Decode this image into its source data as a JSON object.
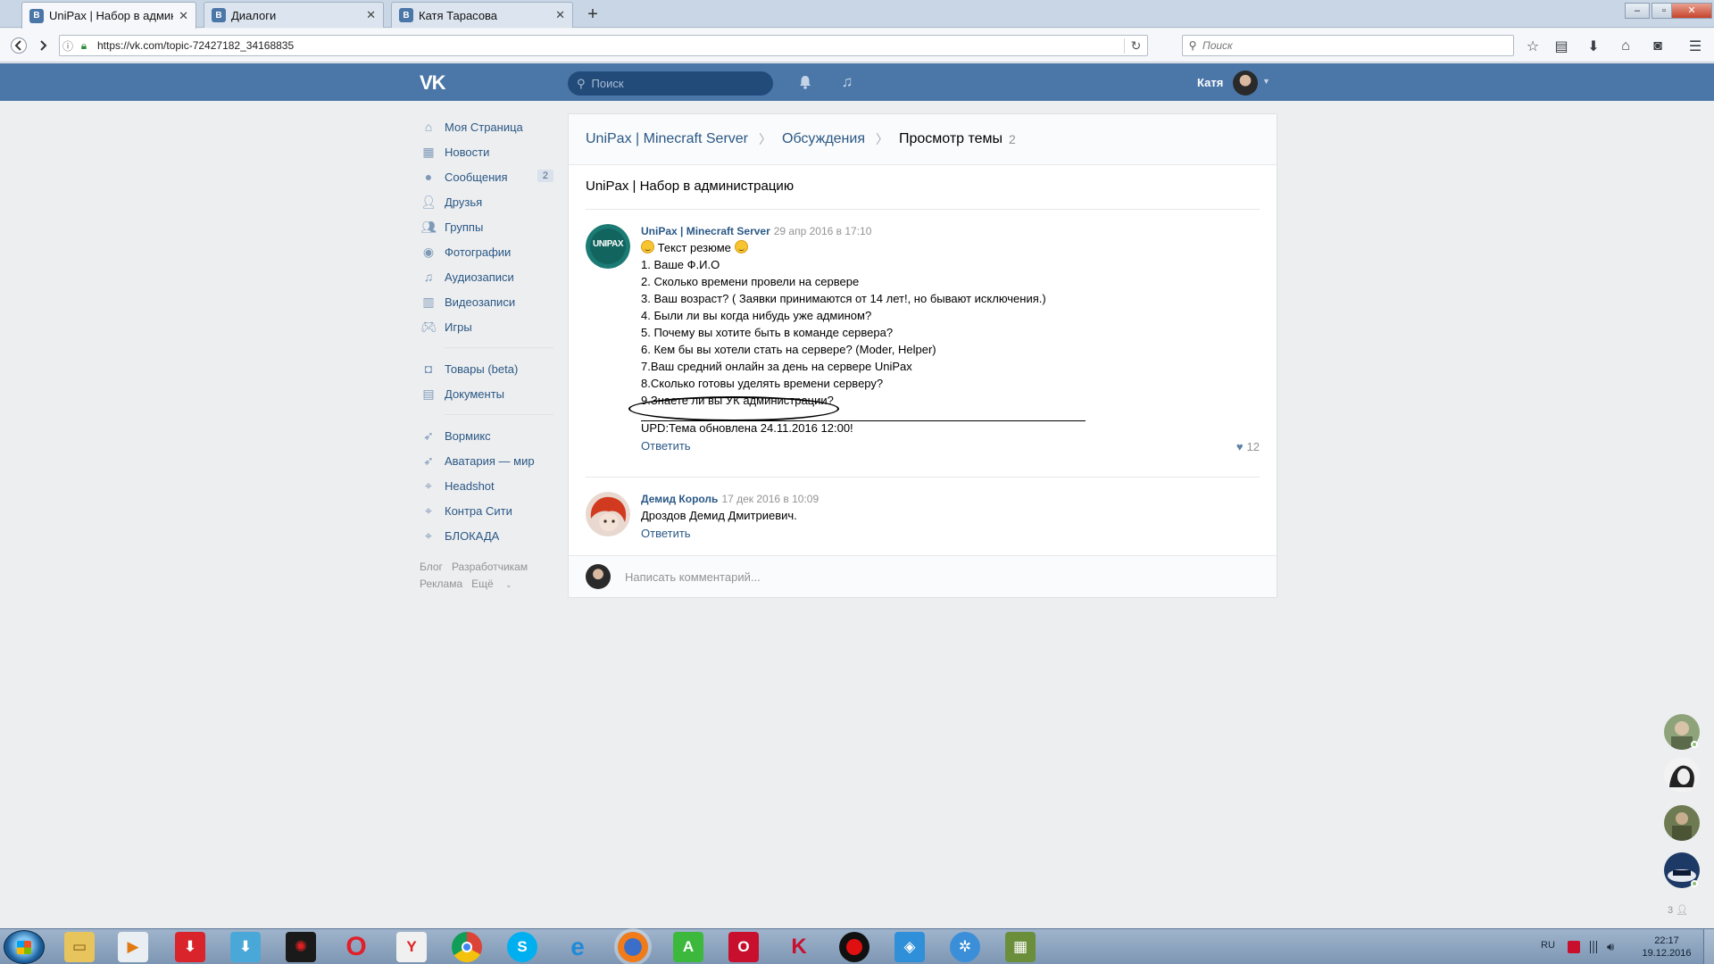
{
  "browser": {
    "tabs": [
      {
        "label": "UniPax | Набор в админис...",
        "icon": "vk-favicon",
        "active": true
      },
      {
        "label": "Диалоги",
        "icon": "vk-favicon",
        "active": false
      },
      {
        "label": "Катя Тарасова",
        "icon": "vk-favicon",
        "active": false
      }
    ],
    "new_tab_label": "+",
    "close_label": "✕",
    "url": "https://vk.com/topic-72427182_34168835",
    "search_placeholder": "Поиск"
  },
  "vk_header": {
    "logo": "VK",
    "search_placeholder": "Поиск",
    "user_name": "Катя"
  },
  "left_nav": {
    "items": [
      {
        "label": "Моя Страница",
        "icon": "home-icon"
      },
      {
        "label": "Новости",
        "icon": "news-icon"
      },
      {
        "label": "Сообщения",
        "icon": "messages-icon",
        "badge": "2"
      },
      {
        "label": "Друзья",
        "icon": "friends-icon"
      },
      {
        "label": "Группы",
        "icon": "groups-icon"
      },
      {
        "label": "Фотографии",
        "icon": "camera-icon"
      },
      {
        "label": "Аудиозаписи",
        "icon": "music-note-icon"
      },
      {
        "label": "Видеозаписи",
        "icon": "film-icon"
      },
      {
        "label": "Игры",
        "icon": "gamepad-icon"
      }
    ],
    "items2": [
      {
        "label": "Товары (beta)",
        "icon": "bag-icon"
      },
      {
        "label": "Документы",
        "icon": "document-icon"
      }
    ],
    "items3": [
      {
        "label": "Вормикс",
        "icon": "rocket-icon"
      },
      {
        "label": "Аватария — мир",
        "icon": "rocket-icon"
      },
      {
        "label": "Headshot",
        "icon": "target-icon"
      },
      {
        "label": "Контра Сити",
        "icon": "target-icon"
      },
      {
        "label": "БЛОКАДА",
        "icon": "target-icon"
      }
    ],
    "footer": {
      "blog": "Блог",
      "dev": "Разработчикам",
      "ads": "Реклама",
      "more": "Ещё"
    }
  },
  "topic": {
    "breadcrumb": {
      "group": "UniPax | Minecraft Server",
      "section": "Обсуждения",
      "current": "Просмотр темы",
      "count": "2"
    },
    "title": "UniPax | Набор в администрацию",
    "posts": [
      {
        "author": "UniPax | Minecraft Server",
        "date": "29 апр 2016 в 17:10",
        "avatar_text": "UNIPAX",
        "lines": [
          "Текст резюме",
          "1. Ваше Ф.И.О",
          "2. Сколько времени провели на сервере",
          "3. Ваш возраст? ( Заявки принимаются от 14 лет!, но бывают исключения.)",
          "4. Были ли вы когда нибудь уже админом?",
          "5. Почему вы хотите быть в команде сервера?",
          "6. Кем бы вы хотели стать на сервере? (Moder, Helper)",
          "7.Ваш средний онлайн за день на сервере UniPax",
          "8.Сколько готовы уделять времени серверу?",
          "9.Знаете ли вы УК администрации?",
          "UPD:Тема обновлена 24.11.2016 12:00!"
        ],
        "reply": "Ответить",
        "likes": "12"
      },
      {
        "author": "Демид Король",
        "date": "17 дек 2016 в 10:09",
        "lines": [
          "Дроздов Демид Дмитриевич."
        ],
        "reply": "Ответить"
      }
    ],
    "comment_placeholder": "Написать комментарий..."
  },
  "friends_sidebar": {
    "count": "3"
  },
  "taskbar": {
    "lang": "RU",
    "time": "22:17",
    "date": "19.12.2016"
  },
  "colors": {
    "vk_blue": "#4a76a8",
    "link": "#2a5885",
    "page_bg": "#edeef0"
  }
}
